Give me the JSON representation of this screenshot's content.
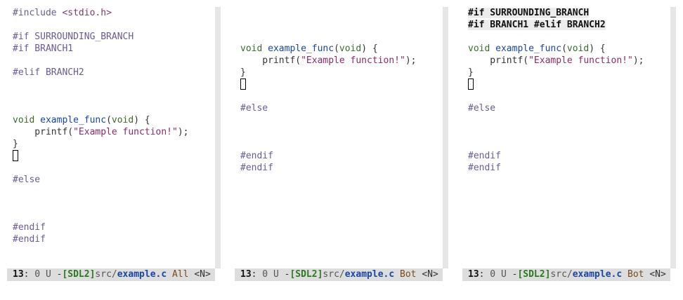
{
  "panes": [
    {
      "lines": {
        "include_kw": "#include",
        "include_hdr": "<stdio.h>",
        "if_surr": "#if SURROUNDING_BRANCH",
        "if_b1": "#if BRANCH1",
        "elif_b2": "#elif BRANCH2",
        "void": "void",
        "func": "example_func",
        "paren_open": "(",
        "void_arg": "void",
        "paren_close": ") {",
        "printf": "    printf(",
        "string": "\"Example function!\"",
        "printf_end": ");",
        "brace": "}",
        "else": "#else",
        "endif1": "#endif",
        "endif2": "#endif"
      },
      "modeline": {
        "line": "13",
        "sep": ":",
        "status": " 0 U ",
        "dash": "-",
        "project": "[SDL2]",
        "dir": "src/",
        "file": "example.c",
        "position": "All",
        "mode": "<N>"
      }
    },
    {
      "lines": {
        "void": "void",
        "func": "example_func",
        "paren_open": "(",
        "void_arg": "void",
        "paren_close": ") {",
        "printf": "    printf(",
        "string": "\"Example function!\"",
        "printf_end": ");",
        "brace": "}",
        "else": "#else",
        "endif1": "#endif",
        "endif2": "#endif"
      },
      "modeline": {
        "line": "13",
        "sep": ":",
        "status": " 0 U ",
        "dash": "-",
        "project": "[SDL2]",
        "dir": "src/",
        "file": "example.c",
        "position": "Bot",
        "mode": "<N>"
      }
    },
    {
      "header": {
        "line1": "#if SURROUNDING_BRANCH",
        "line2": "#if BRANCH1 #elif BRANCH2"
      },
      "lines": {
        "void": "void",
        "func": "example_func",
        "paren_open": "(",
        "void_arg": "void",
        "paren_close": ") {",
        "printf": "    printf(",
        "string": "\"Example function!\"",
        "printf_end": ");",
        "brace": "}",
        "else": "#else",
        "endif1": "#endif",
        "endif2": "#endif"
      },
      "modeline": {
        "line": "13",
        "sep": ":",
        "status": " 0 U ",
        "dash": "-",
        "project": "[SDL2]",
        "dir": "src/",
        "file": "example.c",
        "position": "Bot",
        "mode": "<N>"
      }
    }
  ]
}
